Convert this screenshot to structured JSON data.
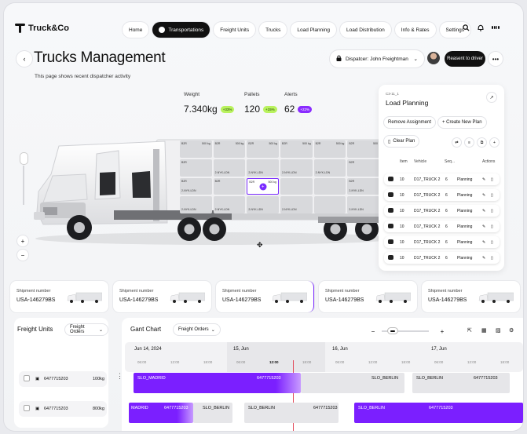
{
  "app": {
    "name": "Truck&Co"
  },
  "nav": {
    "items": [
      "Home",
      "Transportations",
      "Freight Units",
      "Trucks",
      "Load Planning",
      "Load Distribution",
      "Info & Rates",
      "Settings"
    ],
    "active": "Transportations"
  },
  "page": {
    "title": "Trucks Management",
    "subtitle": "This page shows recent dispatcher activity"
  },
  "dispatcher": {
    "label": "Dispatcer: John Freightman"
  },
  "actions": {
    "reassign": "Reasent to driver"
  },
  "stats": [
    {
      "label": "Weight",
      "value": "7.340kg",
      "badge": "+33%",
      "color": "#b9f25e"
    },
    {
      "label": "Pallets",
      "value": "120",
      "badge": "+15%",
      "color": "#b9f25e"
    },
    {
      "label": "Alerts",
      "value": "62",
      "badge": "+22%",
      "color": "#8a2cff"
    }
  ],
  "cargo": {
    "cells": [
      {
        "t": "B2R",
        "r": "500 kg",
        "b": ""
      },
      {
        "t": "B2R",
        "r": "500 kg",
        "b": ""
      },
      {
        "t": "B2R",
        "r": "500 kg",
        "b": ""
      },
      {
        "t": "B2R",
        "r": "500 kg",
        "b": ""
      },
      {
        "t": "B2R",
        "r": "500 kg",
        "b": ""
      },
      {
        "t": "B2R",
        "r": "500",
        "b": ""
      },
      {
        "t": "B2R",
        "r": "",
        "b": ""
      },
      {
        "t": "",
        "r": "",
        "b": "2-NYK-LDN"
      },
      {
        "t": "",
        "r": "",
        "b": "2-NYK-LDN"
      },
      {
        "t": "",
        "r": "",
        "b": "2-NYK-LDN"
      },
      {
        "t": "",
        "r": "",
        "b": "2-NYK-LDN"
      },
      {
        "t": "B2R",
        "r": "",
        "b": ""
      },
      {
        "t": "B2R",
        "r": "",
        "b": "2-NYK-LDN"
      },
      {
        "t": "B2R",
        "r": "",
        "b": ""
      },
      {
        "t": "B2R",
        "r": "500 kg",
        "b": ""
      },
      {
        "t": "",
        "r": "",
        "b": ""
      },
      {
        "t": "",
        "r": "",
        "b": ""
      },
      {
        "t": "B2R",
        "r": "",
        "b": "2-NYK-LDN"
      },
      {
        "t": "",
        "r": "",
        "b": "2-NYK-LDN"
      },
      {
        "t": "",
        "r": "",
        "b": "2-NYK-LDN"
      },
      {
        "t": "",
        "r": "",
        "b": "2-NYK-LDN"
      },
      {
        "t": "",
        "r": "",
        "b": "2-NYK-LDN"
      },
      {
        "t": "",
        "r": "",
        "b": ""
      },
      {
        "t": "",
        "r": "",
        "b": "2-NYK-LDN"
      }
    ],
    "selected_index": 14,
    "selected_symbol": "+"
  },
  "load_planning": {
    "code": "C3-11_1",
    "title": "Load Planning",
    "remove": "Remove Assignment",
    "create": "+ Create New Plan",
    "clear": "Clear Plan",
    "columns": [
      "Item",
      "Vehicle",
      "Seq...",
      "Actions"
    ],
    "rows": [
      {
        "item": "10",
        "vehicle": "D17_TRUCK 2",
        "seq": "6",
        "status": "Planning"
      },
      {
        "item": "10",
        "vehicle": "D17_TRUCK 2",
        "seq": "6",
        "status": "Planning"
      },
      {
        "item": "10",
        "vehicle": "D17_TRUCK 2",
        "seq": "6",
        "status": "Planning"
      },
      {
        "item": "10",
        "vehicle": "D17_TRUCK 2",
        "seq": "6",
        "status": "Planning"
      },
      {
        "item": "10",
        "vehicle": "D17_TRUCK 2",
        "seq": "6",
        "status": "Planning"
      },
      {
        "item": "10",
        "vehicle": "D17_TRUCK 2",
        "seq": "6",
        "status": "Planning"
      }
    ]
  },
  "shipments": [
    {
      "label": "Shipment number",
      "number": "USA-146279BS"
    },
    {
      "label": "Shipment number",
      "number": "USA-146279BS"
    },
    {
      "label": "Shipment number",
      "number": "USA-146279BS"
    },
    {
      "label": "Shipment number",
      "number": "USA-146279BS"
    },
    {
      "label": "Shipment number",
      "number": "USA-146279BS"
    }
  ],
  "freight_units": {
    "title": "Freight Units",
    "filter": "Freight Orders",
    "rows": [
      {
        "id": "6477715203",
        "weight": "100kg"
      },
      {
        "id": "6477715203",
        "weight": "800kg"
      }
    ]
  },
  "gantt": {
    "title": "Gant Chart",
    "filter": "Freight Orders",
    "days": [
      "Jun 14, 2024",
      "15, Jun",
      "16, Jun",
      "17, Jun"
    ],
    "times": [
      "06:00",
      "12:00",
      "18:00",
      "06:00",
      "12:00",
      "18:00",
      "06:00",
      "12:00",
      "18:00",
      "06:00",
      "12:00",
      "18:00"
    ],
    "row1": {
      "a": "SLO_MADRID",
      "a_id": "6477715203",
      "b": "SLO_BERLIN",
      "c": "SLO_BERLIN",
      "c_id": "6477715203"
    },
    "row2": {
      "a": "MADRID",
      "a_id": "6477715203",
      "b": "SLO_BERLIN",
      "c": "SLO_BERLIN",
      "c_id": "6477715203",
      "d": "SLO_BERLIN",
      "d_id": "6477715203"
    }
  },
  "colors": {
    "accent": "#7b2cff",
    "lime": "#b9f25e",
    "dark": "#111111"
  }
}
